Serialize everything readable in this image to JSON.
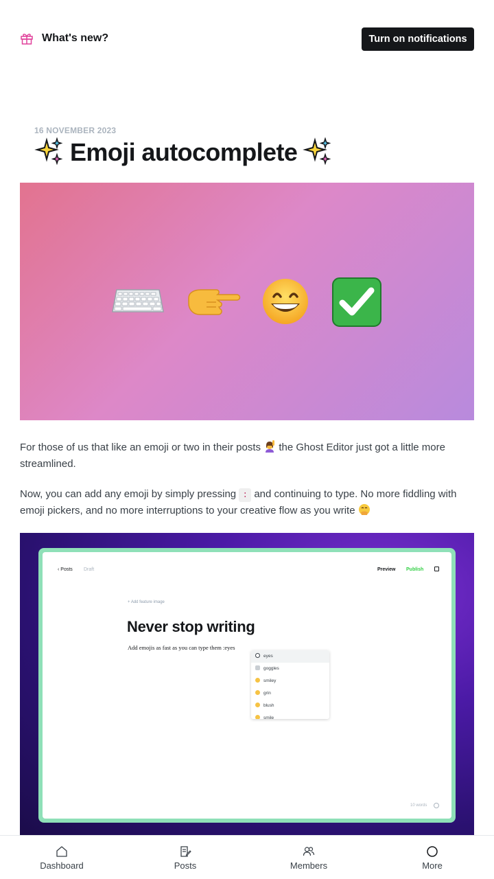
{
  "header": {
    "whats_new": "What's new?",
    "notifications_button": "Turn on notifications"
  },
  "post": {
    "date": "16 NOVEMBER 2023",
    "title": "Emoji autocomplete",
    "hero_emojis": [
      "keyboard",
      "backhand-index-pointing-right",
      "grinning-face-with-smiling-eyes",
      "check-mark-button"
    ],
    "paragraph1_a": "For those of us that like an emoji or two in their posts",
    "paragraph1_b": "the Ghost Editor just got a little more streamlined.",
    "paragraph2_a": "Now, you can add any emoji by simply pressing",
    "paragraph2_key": ":",
    "paragraph2_b": "and continuing to type. No more fiddling with emoji pickers, and no more interruptions to your creative flow as you write"
  },
  "screenshot": {
    "back_label": "‹  Posts",
    "status": "Draft",
    "preview": "Preview",
    "publish": "Publish",
    "feature_image": "+ Add feature image",
    "title": "Never stop writing",
    "body": "Add emojis as fast as you can type them",
    "typed": ":eyes",
    "suggestions": [
      "eyes",
      "goggles",
      "smiley",
      "grin",
      "blush",
      "smile"
    ],
    "word_count": "10 words"
  },
  "nav": {
    "items": [
      {
        "label": "Dashboard",
        "icon": "home-icon"
      },
      {
        "label": "Posts",
        "icon": "posts-icon"
      },
      {
        "label": "Members",
        "icon": "members-icon"
      },
      {
        "label": "More",
        "icon": "more-icon"
      }
    ]
  },
  "colors": {
    "brand_pink": "#e0409a",
    "button_dark": "#15171a",
    "publish_green": "#30cf43",
    "frame_green": "#8fe0b8"
  }
}
